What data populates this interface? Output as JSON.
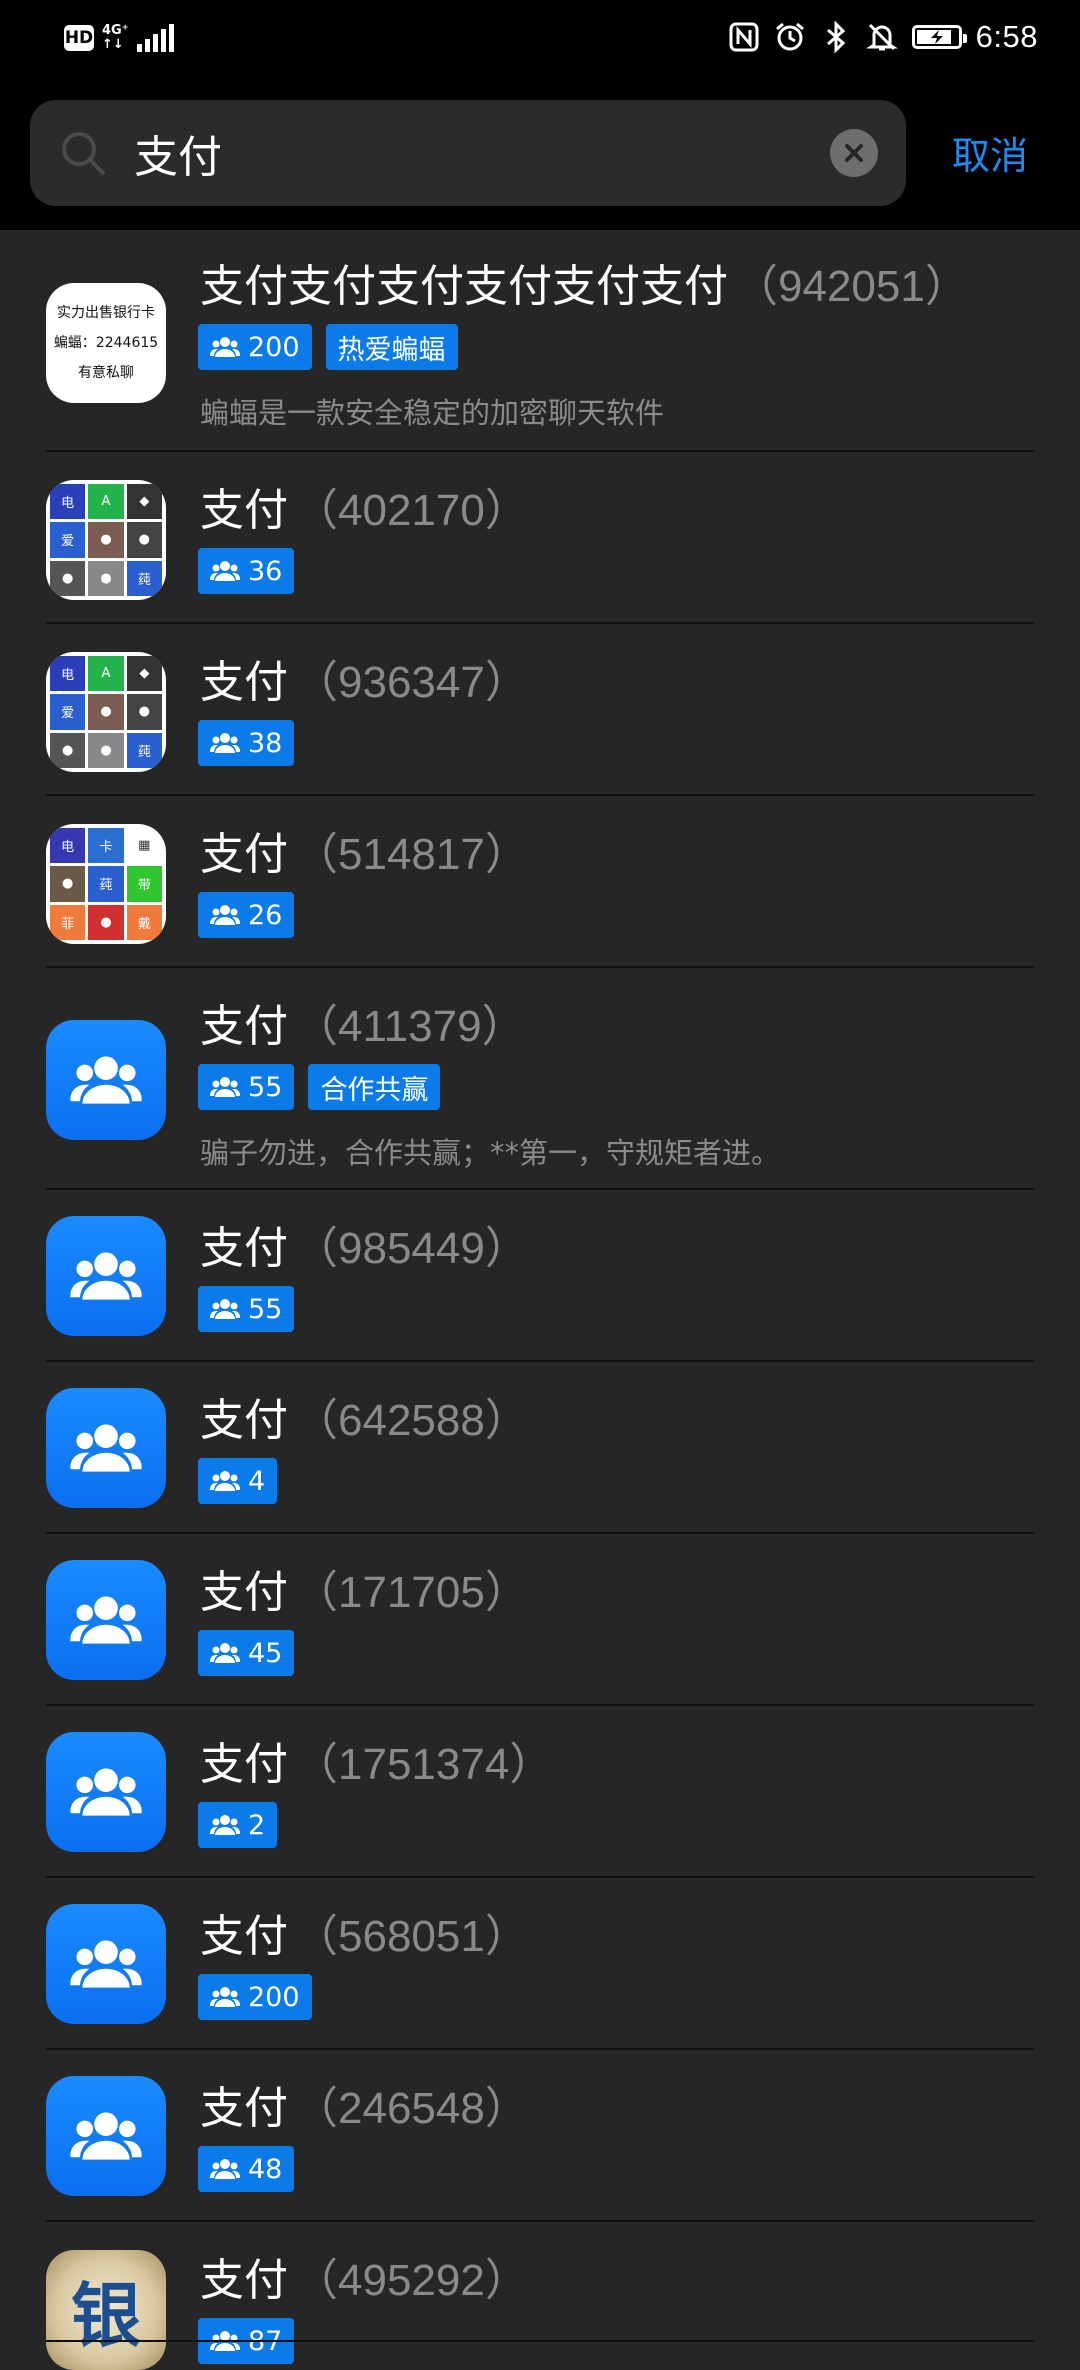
{
  "status_bar": {
    "hd_label": "HD",
    "network_top": "4G⁺",
    "network_bottom": "↑↓",
    "time": "6:58",
    "icons": [
      "nfc-icon",
      "alarm-icon",
      "bluetooth-icon",
      "mute-icon",
      "battery-charging-icon"
    ]
  },
  "search": {
    "query": "支付",
    "cancel_label": "取消"
  },
  "results": [
    {
      "name": "支付支付支付支付支付支付",
      "id": "（942051）",
      "members": "200",
      "tag": "热爱蝙蝠",
      "desc": "蝙蝠是一款安全稳定的加密聊天软件",
      "avatar_lines": [
        "实力出售银行卡",
        "蝙蝠：2244615",
        "有意私聊"
      ]
    },
    {
      "name": "支付",
      "id": "（402170）",
      "members": "36"
    },
    {
      "name": "支付",
      "id": "（936347）",
      "members": "38"
    },
    {
      "name": "支付",
      "id": "（514817）",
      "members": "26"
    },
    {
      "name": "支付",
      "id": "（411379）",
      "members": "55",
      "tag": "合作共赢",
      "desc": "骗子勿进，合作共赢；**第一，守规矩者进。"
    },
    {
      "name": "支付",
      "id": "（985449）",
      "members": "55"
    },
    {
      "name": "支付",
      "id": "（642588）",
      "members": "4"
    },
    {
      "name": "支付",
      "id": "（171705）",
      "members": "45"
    },
    {
      "name": "支付",
      "id": "（1751374）",
      "members": "2"
    },
    {
      "name": "支付",
      "id": "（568051）",
      "members": "200"
    },
    {
      "name": "支付",
      "id": "（246548）",
      "members": "48"
    },
    {
      "name": "支付",
      "id": "（495292）",
      "members": "87",
      "avatar_char": "银"
    }
  ],
  "colors": {
    "accent": "#1e8bf0",
    "chip": "#0a7be8",
    "background": "#262626",
    "header": "#000000"
  }
}
